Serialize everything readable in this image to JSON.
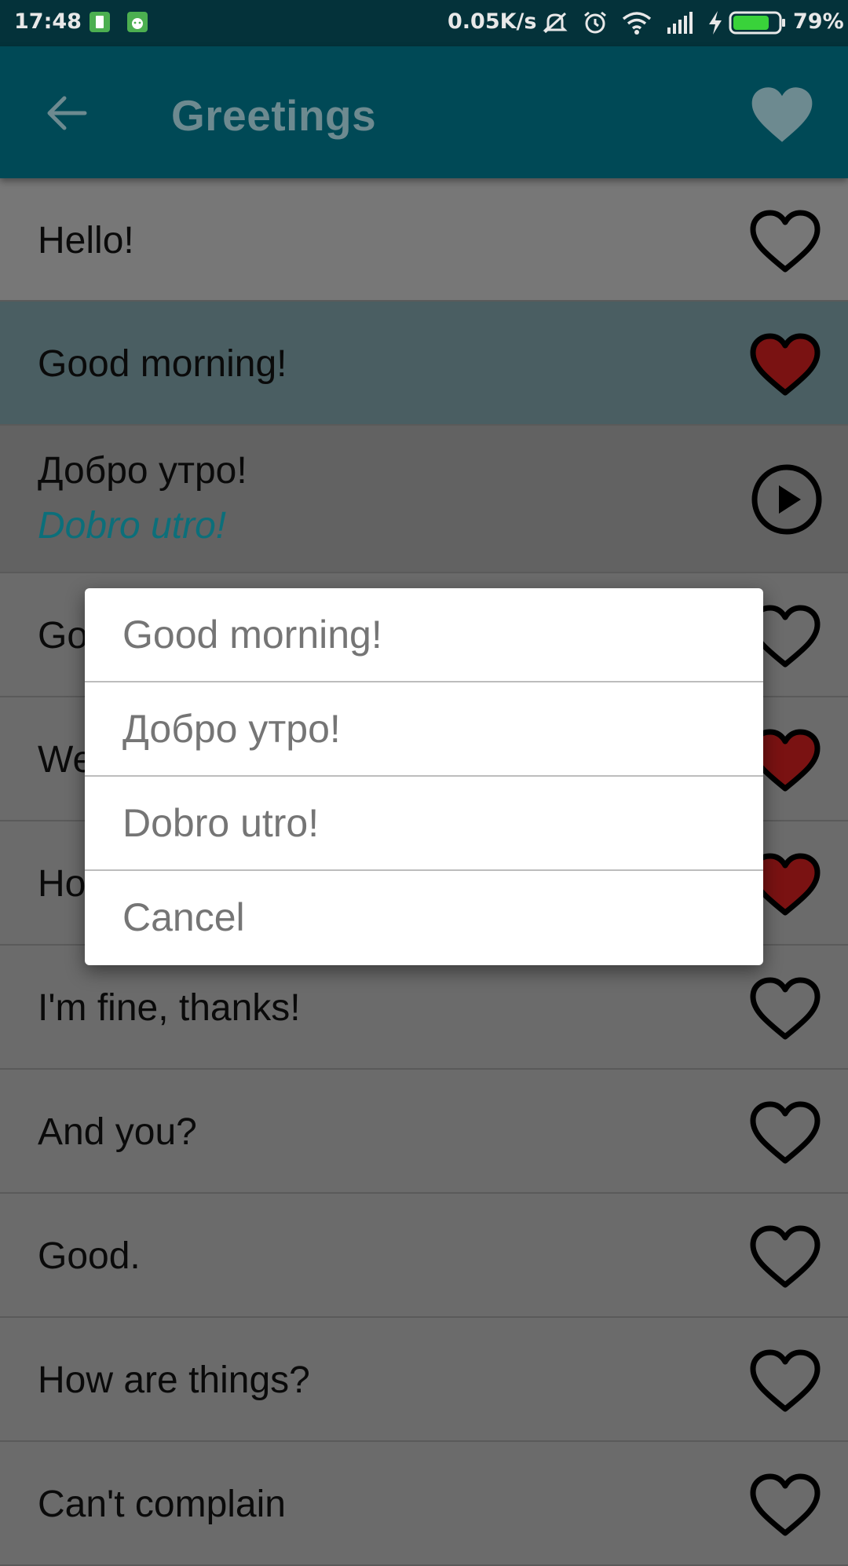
{
  "status_bar": {
    "time": "17:48",
    "net_speed": "0.05K/s",
    "battery_percent": "79%",
    "battery_level": 0.79,
    "icons": [
      "battery-saver-icon",
      "android-icon",
      "mute-icon",
      "alarm-icon",
      "wifi-icon",
      "signal-icon",
      "charging-icon",
      "battery-icon"
    ]
  },
  "app_bar": {
    "title": "Greetings",
    "back_icon": "arrow-left-icon",
    "favorites_icon": "heart-filled-icon"
  },
  "list": {
    "items": [
      {
        "text": "Hello!",
        "favorite": false
      },
      {
        "text": "Good morning!",
        "favorite": true,
        "selected": true
      },
      {
        "text": "Добро утро!",
        "translit": "Dobro utro!",
        "expanded": true
      },
      {
        "text": "Go",
        "favorite": false
      },
      {
        "text": "We",
        "favorite": true
      },
      {
        "text": "Ho",
        "favorite": true
      },
      {
        "text": "I'm fine, thanks!",
        "favorite": false
      },
      {
        "text": "And you?",
        "favorite": false
      },
      {
        "text": "Good.",
        "favorite": false
      },
      {
        "text": "How are things?",
        "favorite": false
      },
      {
        "text": "Can't complain",
        "favorite": false
      }
    ]
  },
  "dialog": {
    "options": [
      "Good morning!",
      "Добро утро!",
      "Dobro utro!",
      "Cancel"
    ]
  },
  "colors": {
    "status_bar": "#04323a",
    "app_bar": "#004956",
    "title_text": "#6d8a90",
    "selected_row": "#4a5e62",
    "translit_text": "#0c6f7a",
    "heart_filled": "#7a1212"
  }
}
